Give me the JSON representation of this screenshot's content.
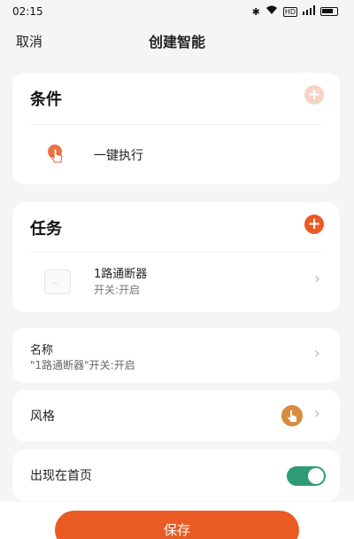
{
  "status_bar": {
    "time": "02:15",
    "network_badge": "HD"
  },
  "header": {
    "cancel_label": "取消",
    "title": "创建智能"
  },
  "conditions": {
    "heading": "条件",
    "item_label": "一键执行"
  },
  "tasks": {
    "heading": "任务",
    "device_name": "1路通断器",
    "device_action": "开关:开启"
  },
  "name_row": {
    "label": "名称",
    "value": "\"1路通断器\"开关:开启"
  },
  "style_row": {
    "label": "风格"
  },
  "home_row": {
    "label": "出现在首页",
    "toggle_on": true
  },
  "footer": {
    "save_label": "保存"
  },
  "colors": {
    "accent": "#e95b23",
    "toggle": "#2e9b76",
    "background": "#f5f5f5"
  },
  "icons": [
    "bluetooth-icon",
    "wifi-icon",
    "signal-icon",
    "battery-icon",
    "add-icon",
    "hand-tap-icon",
    "device-icon",
    "chevron-right-icon",
    "style-avatar-icon"
  ]
}
